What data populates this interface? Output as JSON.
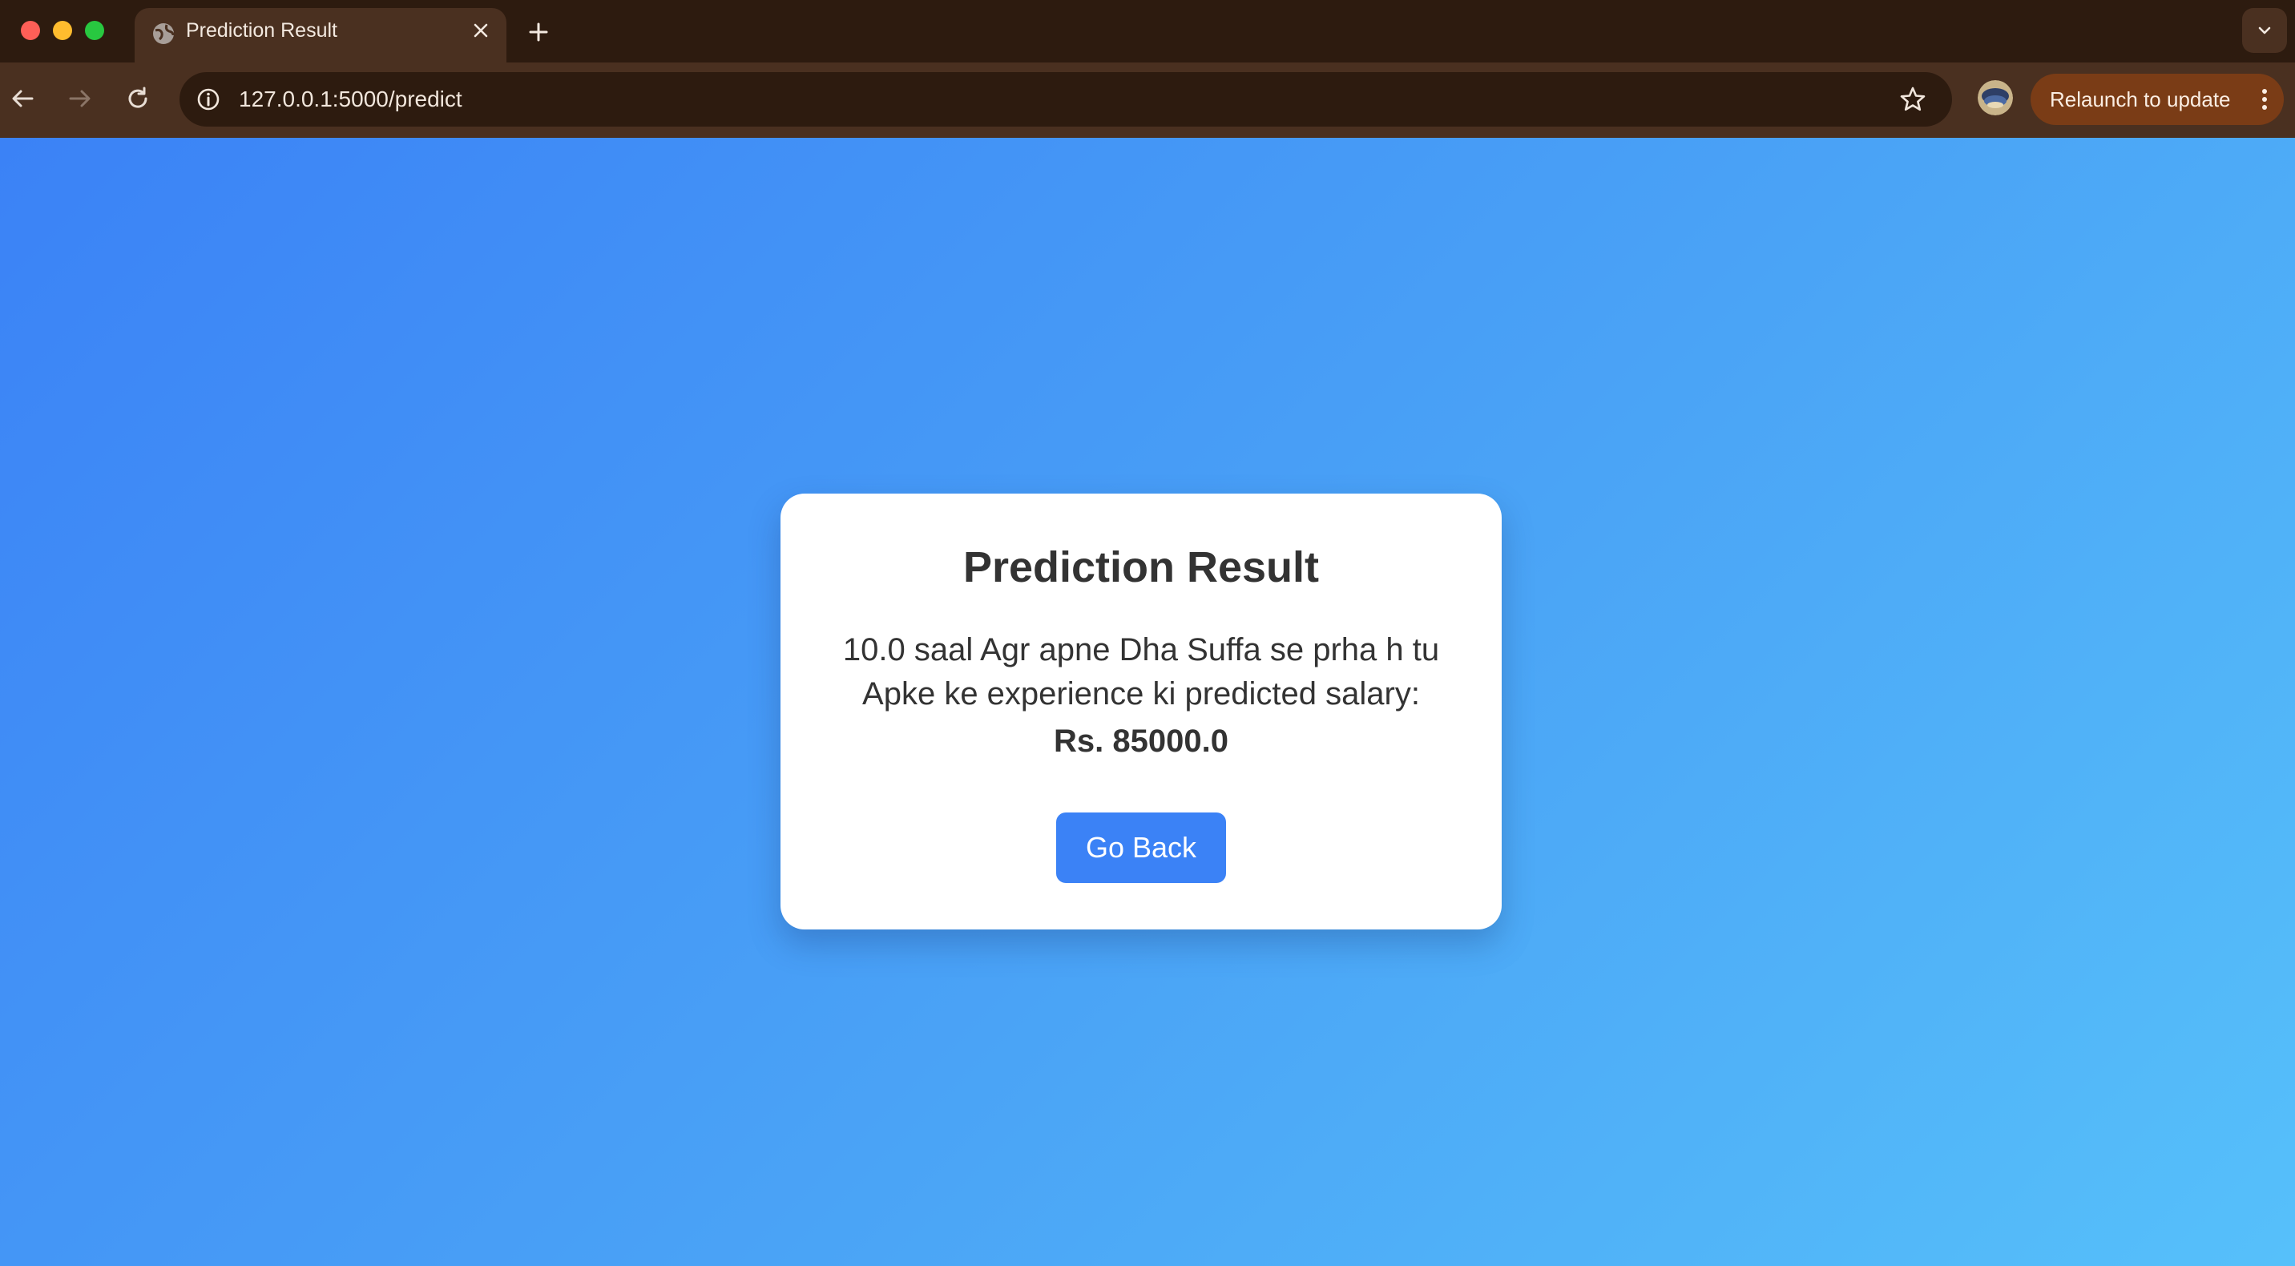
{
  "browser": {
    "tab": {
      "title": "Prediction Result",
      "favicon_icon": "globe-icon",
      "close_icon": "close-icon"
    },
    "new_tab_icon": "plus-icon",
    "tab_search_icon": "chevron-down-icon",
    "nav": {
      "back_icon": "arrow-left-icon",
      "forward_icon": "arrow-right-icon",
      "reload_icon": "reload-icon"
    },
    "omnibox": {
      "site_info_icon": "info-icon",
      "url": "127.0.0.1:5000/predict",
      "bookmark_icon": "star-icon"
    },
    "relaunch": {
      "label": "Relaunch to update",
      "menu_icon": "more-vertical-icon"
    },
    "colors": {
      "tabbar": "#2d1b0f",
      "toolbar": "#4a3020",
      "relaunch": "#7a3c16"
    }
  },
  "page": {
    "card": {
      "title": "Prediction Result",
      "message": "10.0 saal Agr apne Dha Suffa se prha h tu Apke ke experience ki predicted salary:",
      "salary": "Rs. 85000.0",
      "button_label": "Go Back"
    },
    "colors": {
      "gradient_start": "#3b82f6",
      "gradient_end": "#56c0fa",
      "button": "#3b82f6",
      "text": "#333333"
    }
  }
}
